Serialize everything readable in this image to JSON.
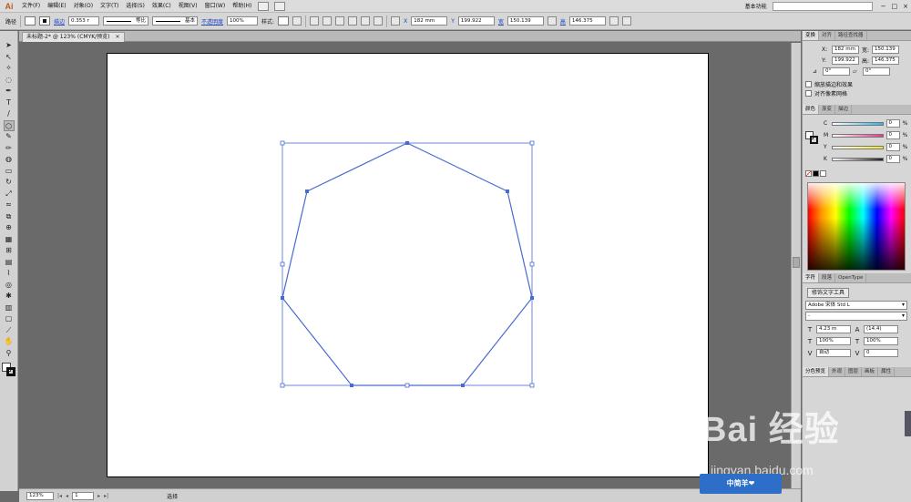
{
  "menubar": {
    "logo": "Ai",
    "items": [
      "文件(F)",
      "编辑(E)",
      "对象(O)",
      "文字(T)",
      "选择(S)",
      "效果(C)",
      "视图(V)",
      "窗口(W)",
      "帮助(H)"
    ],
    "workspace": "基本功能",
    "search_placeholder": "",
    "window_buttons": [
      "−",
      "□",
      "×"
    ]
  },
  "controlbar": {
    "object_type": "路径",
    "stroke_label": "描边",
    "stroke_value": "0.353 r",
    "profile_label": "等比",
    "brush_label": "基本",
    "opacity_label": "不透明度",
    "opacity_value": "100%",
    "style_label": "样式:",
    "x_value": "182 mm",
    "y_value": "199.922",
    "w_label": "宽",
    "w_value": "150.139",
    "h_label": "高",
    "h_value": "146.375"
  },
  "document": {
    "tab_title": "未标题-2* @ 123% (CMYK/预览)",
    "tab_close": "×"
  },
  "statusbar": {
    "zoom": "123%",
    "page": "1",
    "status": "选择",
    "nav_first": "|◂",
    "nav_prev": "◂",
    "nav_next": "▸",
    "nav_last": "▸|"
  },
  "transform_panel": {
    "tabs": [
      "变换",
      "对齐",
      "路径查找器"
    ],
    "x_label": "X:",
    "x_value": "182 mm",
    "y_label": "Y:",
    "y_value": "199.922",
    "w_label": "宽:",
    "w_value": "150.139",
    "h_label": "高:",
    "h_value": "146.375",
    "angle_value": "0°",
    "shear_value": "0°",
    "scale_strokes": "缩放描边和效果",
    "align_pixel": "对齐像素网格"
  },
  "color_panel": {
    "tabs": [
      "颜色",
      "渐变",
      "描边"
    ],
    "channels": [
      {
        "label": "C",
        "value": "0",
        "color": "#24b6e6"
      },
      {
        "label": "M",
        "value": "0",
        "color": "#e8358d"
      },
      {
        "label": "Y",
        "value": "0",
        "color": "#f2e81b"
      },
      {
        "label": "K",
        "value": "0",
        "color": "#222222"
      }
    ],
    "unit": "%"
  },
  "character_panel": {
    "tabs": [
      "字符",
      "段落",
      "OpenType"
    ],
    "touch_button": "修饰文字工具",
    "font_family": "Adobe 宋体 Std L",
    "font_style": "-",
    "font_size": "4.23 m",
    "leading": "(14.4)",
    "vscale": "100%",
    "hscale": "100%",
    "kerning": "自动",
    "tracking": "0"
  },
  "bottom_tabs": [
    "分色预览",
    "外观",
    "图层",
    "画板",
    "属性"
  ],
  "watermark": {
    "brand": "Bai 经验",
    "url": "jingyan.baidu.com",
    "badge": "中简羊❤"
  },
  "colors": {
    "selection": "#4a6ad0",
    "ui_bg": "#d6d6d6",
    "pasteboard": "#6a6a6a"
  },
  "tools": [
    "selection-icon",
    "direct-selection-icon",
    "magic-wand-icon",
    "lasso-icon",
    "pen-icon",
    "type-icon",
    "line-icon",
    "polygon-icon",
    "paintbrush-icon",
    "pencil-icon",
    "blob-brush-icon",
    "eraser-icon",
    "rotate-icon",
    "scale-icon",
    "warp-icon",
    "free-transform-icon",
    "shape-builder-icon",
    "perspective-icon",
    "mesh-icon",
    "gradient-icon",
    "eyedropper-icon",
    "blend-icon",
    "symbol-sprayer-icon",
    "column-graph-icon",
    "artboard-icon",
    "slice-icon",
    "hand-icon",
    "zoom-icon"
  ]
}
